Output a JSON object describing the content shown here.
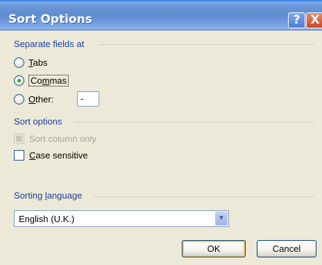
{
  "dialog": {
    "title": "Sort Options",
    "help_glyph": "?",
    "close_glyph": "X"
  },
  "separate_group": {
    "label": "Separate fields at",
    "options": [
      {
        "label": "Tabs",
        "accel": "T",
        "rest": "abs",
        "selected": false
      },
      {
        "label": "Commas",
        "accel": "m",
        "pre": "Co",
        "rest": "mas",
        "selected": true
      },
      {
        "label": "Other:",
        "accel": "O",
        "rest": "ther:",
        "selected": false
      }
    ],
    "other_value": "-"
  },
  "sort_group": {
    "label": "Sort options",
    "sort_column_only": {
      "label": "Sort column only",
      "enabled": false,
      "checked": false
    },
    "case_sensitive": {
      "label": "Case sensitive",
      "accel": "C",
      "rest": "ase sensitive",
      "checked": false
    }
  },
  "language_group": {
    "label": "Sorting language",
    "accel_pre": "Sorting ",
    "accel": "l",
    "accel_rest": "anguage",
    "selected": "English (U.K.)"
  },
  "buttons": {
    "ok": "OK",
    "cancel": "Cancel"
  }
}
